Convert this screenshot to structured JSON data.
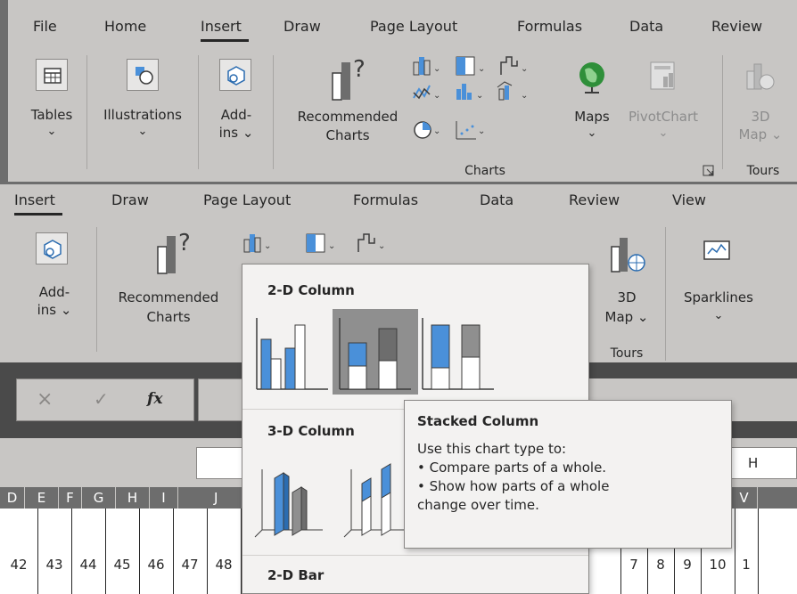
{
  "ribbon_top": {
    "tabs": [
      "File",
      "Home",
      "Insert",
      "Draw",
      "Page Layout",
      "Formulas",
      "Data",
      "Review"
    ],
    "active_tab": "Insert",
    "groups": {
      "tables": {
        "line1": "Tables",
        "line2": "⌄"
      },
      "illustrations": {
        "line1": "Illustrations",
        "line2": "⌄"
      },
      "addins": {
        "line1": "Add-",
        "line2": "ins ⌄"
      },
      "recommended": {
        "line1": "Recommended",
        "line2": "Charts"
      },
      "maps": {
        "line1": "Maps",
        "line2": "⌄"
      },
      "pivotchart": {
        "line1": "PivotChart",
        "line2": "⌄"
      },
      "map3d": {
        "line1": "3D",
        "line2": "Map ⌄"
      }
    },
    "group_labels": {
      "charts": "Charts",
      "tours": "Tours"
    }
  },
  "ribbon_second": {
    "tabs": [
      "Insert",
      "Draw",
      "Page Layout",
      "Formulas",
      "Data",
      "Review",
      "View"
    ],
    "active_tab": "Insert",
    "addins": {
      "line1": "Add-",
      "line2": "ins ⌄"
    },
    "recommended": {
      "line1": "Recommended",
      "line2": "Charts"
    },
    "map3d": {
      "line1": "3D",
      "line2": "Map ⌄"
    },
    "sparklines": {
      "line1": "Sparklines",
      "line2": "⌄"
    },
    "tours": "Tours"
  },
  "formula_bar": {
    "cancel": "×",
    "enter": "✓",
    "fx": "fx"
  },
  "namebox_right": "H",
  "column_headers": [
    "D",
    "E",
    "F",
    "G",
    "H",
    "I",
    "J",
    "V"
  ],
  "row_numbers_left": [
    "42",
    "43",
    "44",
    "45",
    "46",
    "47",
    "48"
  ],
  "row_numbers_right": [
    "7",
    "8",
    "9",
    "10",
    "1"
  ],
  "dropdown": {
    "sections": {
      "col2d": "2-D Column",
      "col3d": "3-D Column",
      "bar2d": "2-D Bar"
    }
  },
  "tooltip": {
    "title": "Stacked Column",
    "lines": [
      "Use this chart type to:",
      "• Compare parts of a whole.",
      "• Show how parts of a whole",
      "change over time."
    ]
  },
  "colors": {
    "ribbon": "#c8c6c4",
    "dark": "#6d6d6d",
    "accent_blue": "#4a90d9",
    "selected": "#8f8f8f"
  }
}
